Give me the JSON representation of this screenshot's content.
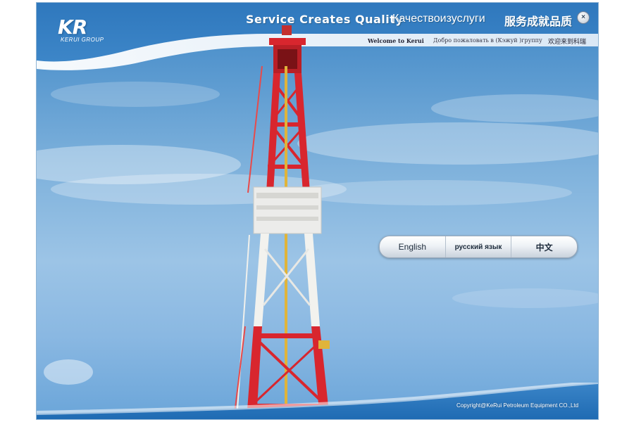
{
  "window": {
    "logo": {
      "mark": "KR",
      "sub": "KERUI GROUP"
    },
    "slogan": {
      "en": "Service Creates Quality",
      "ru": "Качествоизуслуги",
      "zh": "服务成就品质"
    },
    "close_label": "×",
    "welcome": {
      "en": "Welcome to Kerui",
      "ru": "Добро пожаловать в (Кэжуй )группу",
      "zh": "欢迎来到科瑞"
    },
    "languages": [
      {
        "label": "English"
      },
      {
        "label": "русский язык"
      },
      {
        "label": "中文"
      }
    ],
    "copyright": "Copyright@KeRui Petroleum Equipment CO.,Ltd"
  },
  "colors": {
    "sky_top": "#3f87c6",
    "sky_mid": "#9cc4e6",
    "rig_red": "#d8262e",
    "rig_white": "#f2f2ee"
  }
}
